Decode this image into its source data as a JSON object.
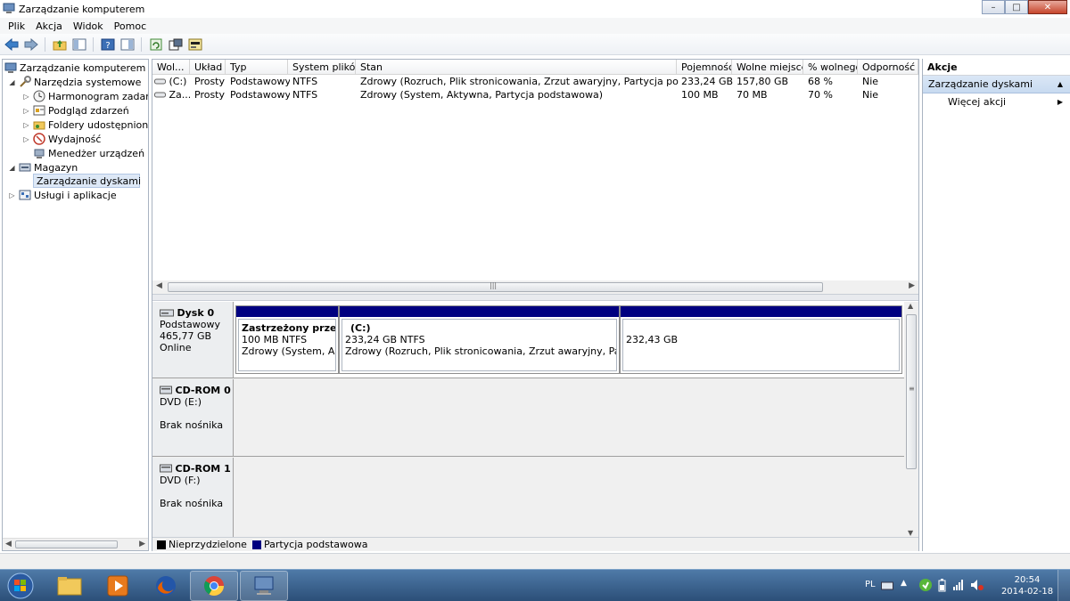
{
  "window": {
    "title": "Zarządzanie komputerem"
  },
  "menu": [
    "Plik",
    "Akcja",
    "Widok",
    "Pomoc"
  ],
  "tree": {
    "root": "Zarządzanie komputerem (loka",
    "system_tools": "Narzędzia systemowe",
    "task_scheduler": "Harmonogram zadań",
    "event_viewer": "Podgląd zdarzeń",
    "shared_folders": "Foldery udostępnione",
    "performance": "Wydajność",
    "device_manager": "Menedżer urządzeń",
    "storage": "Magazyn",
    "disk_management": "Zarządzanie dyskami",
    "services_apps": "Usługi i aplikacje"
  },
  "volume_table": {
    "columns": [
      "Wol...",
      "Układ",
      "Typ",
      "System plików",
      "Stan",
      "Pojemność",
      "Wolne miejsce",
      "% wolnego",
      "Odporność na"
    ],
    "rows": [
      [
        "(C:)",
        "Prosty",
        "Podstawowy",
        "NTFS",
        "Zdrowy (Rozruch, Plik stronicowania, Zrzut awaryjny, Partycja podstawowa)",
        "233,24 GB",
        "157,80 GB",
        "68 %",
        "Nie"
      ],
      [
        "Za...",
        "Prosty",
        "Podstawowy",
        "NTFS",
        "Zdrowy (System, Aktywna, Partycja podstawowa)",
        "100 MB",
        "70 MB",
        "70 %",
        "Nie"
      ]
    ]
  },
  "disks": {
    "disk0": {
      "name": "Dysk 0",
      "type": "Podstawowy",
      "size": "465,77 GB",
      "status": "Online",
      "partitions": [
        {
          "title": "Zastrzeżony przez sys",
          "size": "100 MB NTFS",
          "status": "Zdrowy (System, Akty"
        },
        {
          "title": "(C:)",
          "size": "233,24 GB NTFS",
          "status": "Zdrowy (Rozruch, Plik stronicowania, Zrzut awaryjny, Partycja pod"
        },
        {
          "title": "",
          "size": "232,43 GB",
          "status": ""
        }
      ]
    },
    "cdrom0": {
      "name": "CD-ROM 0",
      "drive": "DVD (E:)",
      "media": "Brak nośnika"
    },
    "cdrom1": {
      "name": "CD-ROM 1",
      "drive": "DVD (F:)",
      "media": "Brak nośnika"
    }
  },
  "legend": {
    "unallocated": "Nieprzydzielone",
    "primary": "Partycja podstawowa"
  },
  "colors": {
    "unallocated": "#000000",
    "primary": "#000080"
  },
  "actions": {
    "header": "Akcje",
    "section": "Zarządzanie dyskami",
    "more": "Więcej akcji"
  },
  "tray": {
    "language": "PL",
    "time": "20:54",
    "date": "2014-02-18"
  }
}
